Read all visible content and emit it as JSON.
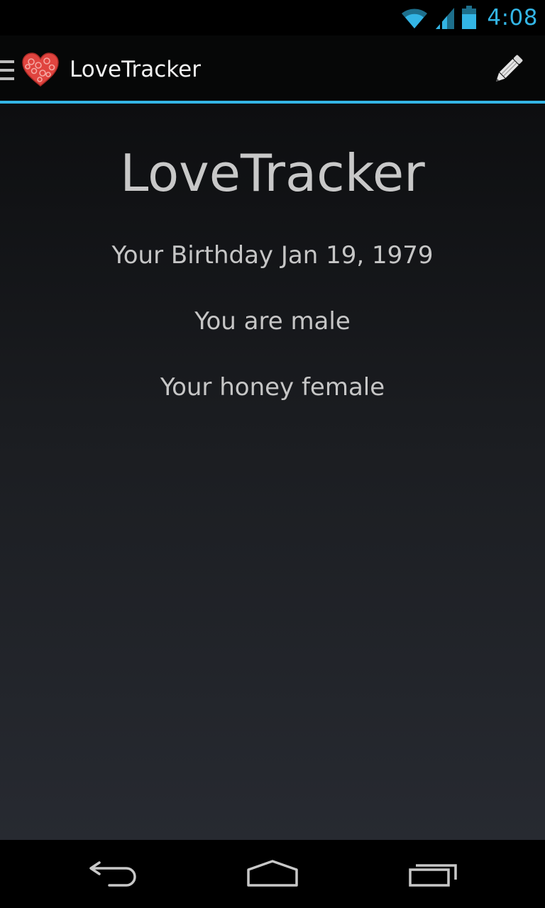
{
  "status_bar": {
    "time": "4:08",
    "icons": [
      "wifi-icon",
      "signal-icon",
      "battery-icon"
    ],
    "accent_color": "#33b5e5"
  },
  "action_bar": {
    "title": "LoveTracker",
    "icons": [
      "drawer-indicator-icon",
      "heart-logo-icon",
      "pencil-icon"
    ],
    "divider_color": "#33b5e5"
  },
  "content": {
    "title": "LoveTracker",
    "birthday": "Your Birthday Jan 19, 1979",
    "gender": "You are male",
    "honey": "Your honey female"
  },
  "nav_bar": {
    "icons": [
      "back-icon",
      "home-icon",
      "recents-icon"
    ]
  }
}
